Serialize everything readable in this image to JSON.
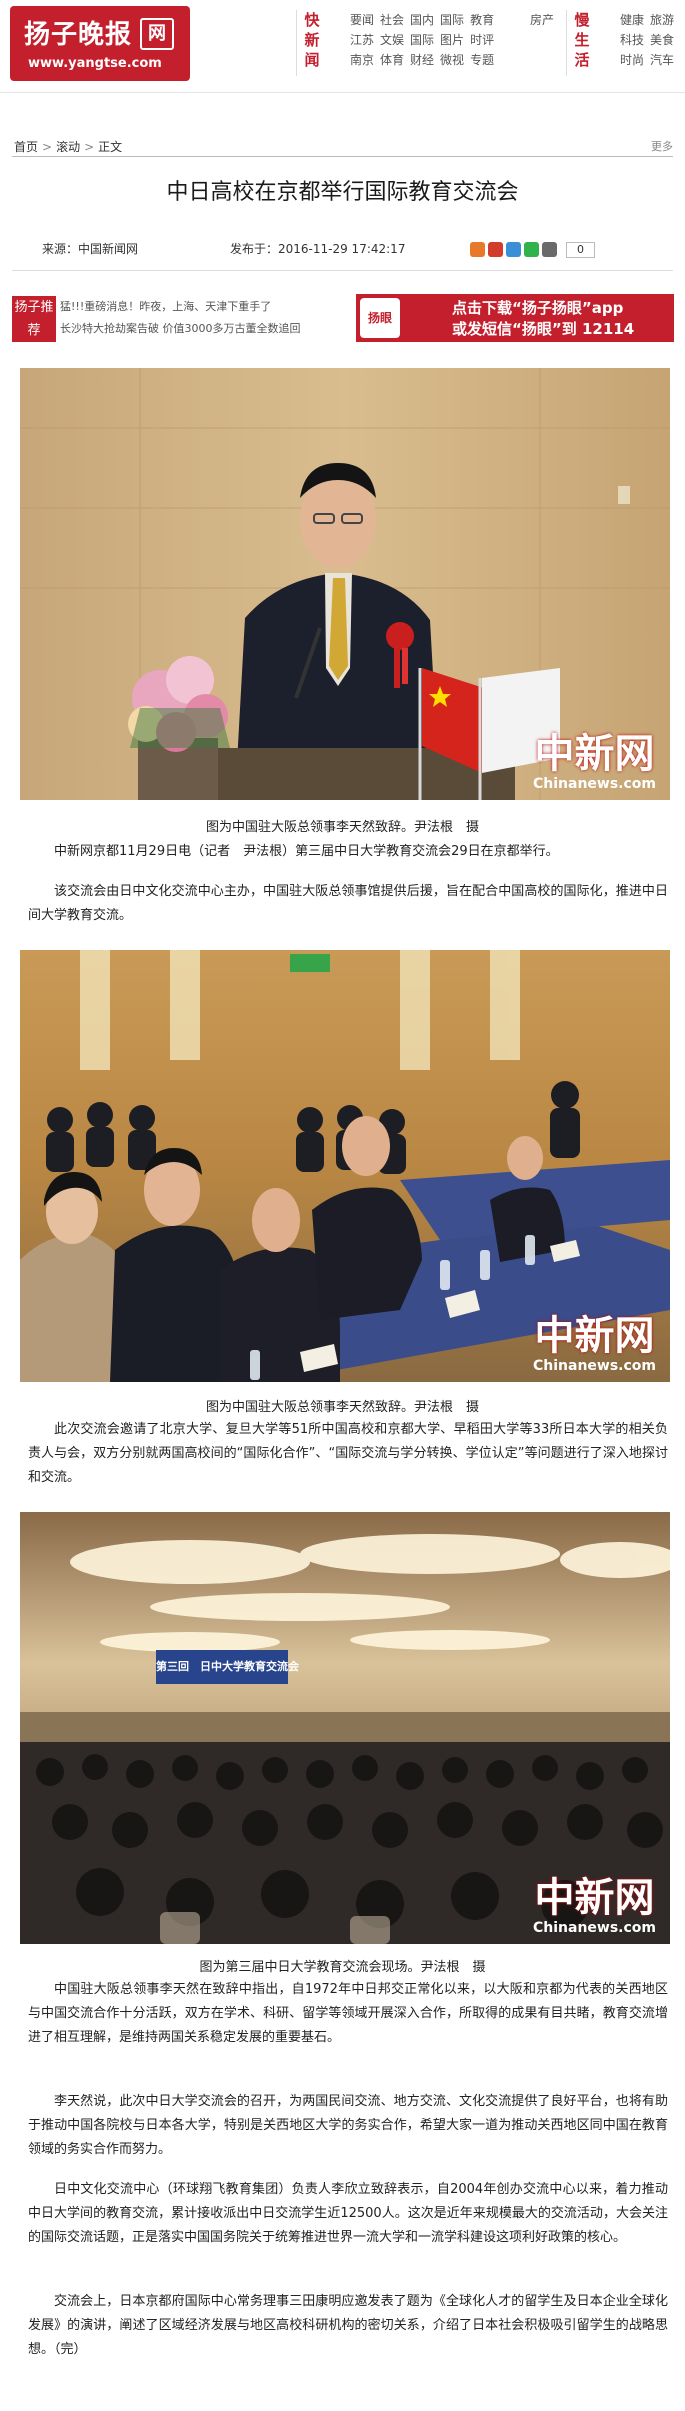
{
  "header": {
    "logo_text": "扬子晚报",
    "logo_badge": "网",
    "logo_url": "www.yangtse.com",
    "channel_group_1": "快新闻",
    "channel_row_1": [
      "要闻",
      "社会",
      "国内",
      "国际",
      "教育"
    ],
    "channel_row_2": [
      "江苏",
      "文娱",
      "国际",
      "图片",
      "时评"
    ],
    "channel_row_3": [
      "南京",
      "体育",
      "财经",
      "微视",
      "专题"
    ],
    "channel_row_1b": [
      "房产"
    ],
    "channel_group_2": "慢生活",
    "life_row_1": [
      "健康",
      "旅游"
    ],
    "life_row_2": [
      "科技",
      "美食"
    ],
    "life_row_3": [
      "时尚",
      "汽车"
    ]
  },
  "breadcrumb": [
    "首页",
    "滚动",
    "正文"
  ],
  "more_label": "更多",
  "article": {
    "title": "中日高校在京都举行国际教育交流会",
    "source": "来源：中国新闻网",
    "publish_time": "发布于：2016-11-29 17:42:17",
    "share_count": "0"
  },
  "recommend": {
    "tag": "扬子推荐",
    "items": [
      "猛!!!重磅消息！昨夜，上海、天津下重手了",
      "长沙特大抢劫案告破 价值3000多万古董全数追回"
    ]
  },
  "ad": {
    "app_name": "扬眼",
    "line1": "点击下载“扬子扬眼”app",
    "line2": "或发短信“扬眼”到 12114"
  },
  "photos": [
    {
      "watermark": "中新网",
      "watermark_en": "Chinanews.com",
      "caption": "图为中国驻大阪总领事李天然致辞。尹法根　摄"
    },
    {
      "watermark": "中新网",
      "watermark_en": "Chinanews.com",
      "caption": "图为中国驻大阪总领事李天然致辞。尹法根　摄"
    },
    {
      "watermark": "中新网",
      "watermark_en": "Chinanews.com",
      "banner": "第三回　日中大学教育交流会",
      "caption": "图为第三届中日大学教育交流会现场。尹法根　摄"
    }
  ],
  "paragraphs": {
    "p1": "中新网京都11月29日电（记者　尹法根）第三届中日大学教育交流会29日在京都举行。",
    "p2": "该交流会由日中文化交流中心主办，中国驻大阪总领事馆提供后援，旨在配合中国高校的国际化，推进中日间大学教育交流。",
    "p3": "此次交流会邀请了北京大学、复旦大学等51所中国高校和京都大学、早稻田大学等33所日本大学的相关负责人与会，双方分别就两国高校间的“国际化合作”、“国际交流与学分转换、学位认定”等问题进行了深入地探讨和交流。",
    "p4": "中国驻大阪总领事李天然在致辞中指出，自1972年中日邦交正常化以来，以大阪和京都为代表的关西地区与中国交流合作十分活跃，双方在学术、科研、留学等领域开展深入合作，所取得的成果有目共睹，教育交流增进了相互理解，是维持两国关系稳定发展的重要基石。",
    "p5": "李天然说，此次中日大学交流会的召开，为两国民间交流、地方交流、文化交流提供了良好平台，也将有助于推动中国各院校与日本各大学，特别是关西地区大学的务实合作，希望大家一道为推动关西地区同中国在教育领域的务实合作而努力。",
    "p6": "日中文化交流中心（环球翔飞教育集团）负责人李欣立致辞表示，自2004年创办交流中心以来，着力推动中日大学间的教育交流，累计接收派出中日交流学生近12500人。这次是近年来规模最大的交流活动，大会关注的国际交流话题，正是落实中国国务院关于统筹推进世界一流大学和一流学科建设这项利好政策的核心。",
    "p7": "交流会上，日本京都府国际中心常务理事三田康明应邀发表了题为《全球化人才的留学生及日本企业全球化发展》的演讲，阐述了区域经济发展与地区高校科研机构的密切关系，介绍了日本社会积极吸引留学生的战略思想。（完）"
  }
}
